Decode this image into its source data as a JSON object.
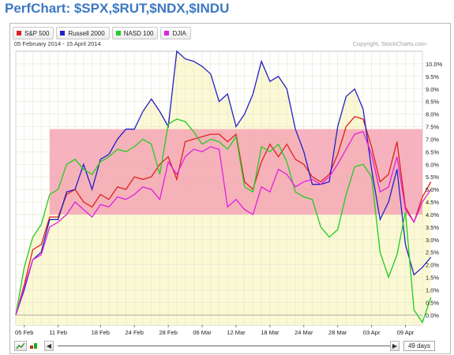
{
  "page_title": "PerfChart: $SPX,$RUT,$NDX,$INDU",
  "date_range": "05 February 2014 - 15 April 2014",
  "copyright": "Copyright, StockCharts.com",
  "legend": [
    {
      "label": "S&P 500",
      "color": "#e02020"
    },
    {
      "label": "Russell 2000",
      "color": "#2020c8"
    },
    {
      "label": "NASD 100",
      "color": "#22cc22"
    },
    {
      "label": "DJIA",
      "color": "#e020e0"
    }
  ],
  "controls": {
    "days_label": "49 days",
    "left_arrow": "◀",
    "right_arrow": "▶"
  },
  "icons": [
    "line-chart-icon",
    "bar-chart-icon",
    "left-arrow-icon",
    "right-arrow-icon"
  ],
  "chart_data": {
    "type": "line",
    "x_ticks": [
      "05 Feb",
      "11 Feb",
      "18 Feb",
      "24 Feb",
      "28 Feb",
      "06 Mar",
      "12 Mar",
      "18 Mar",
      "24 Mar",
      "28 Mar",
      "03 Apr",
      "09 Apr"
    ],
    "x_tick_index": [
      1,
      5,
      10,
      14,
      18,
      22,
      26,
      30,
      34,
      38,
      42,
      46
    ],
    "y_ticks": [
      "0.0%",
      "0.5%",
      "1.0%",
      "1.5%",
      "2.0%",
      "2.5%",
      "3.0%",
      "3.5%",
      "4.0%",
      "4.5%",
      "5.0%",
      "5.5%",
      "6.0%",
      "6.5%",
      "7.0%",
      "7.5%",
      "8.0%",
      "8.5%",
      "9.0%",
      "9.5%",
      "10.0%"
    ],
    "ylim": [
      -0.4,
      10.5
    ],
    "xlim": [
      0,
      48
    ],
    "band": {
      "from": 4.0,
      "to": 7.4,
      "color": "#f4a6b4"
    },
    "lower_fill_color": "#fbf8d4",
    "series": [
      {
        "name": "S&P 500",
        "color": "#e02020",
        "values": [
          0.0,
          1.2,
          2.6,
          2.8,
          3.9,
          3.9,
          4.8,
          5.0,
          4.5,
          4.3,
          4.8,
          4.6,
          5.1,
          5.0,
          5.5,
          5.4,
          5.5,
          6.0,
          6.3,
          5.4,
          6.9,
          7.0,
          7.1,
          7.2,
          7.2,
          6.9,
          7.2,
          5.3,
          5.0,
          6.1,
          6.8,
          6.3,
          6.8,
          6.2,
          6.0,
          5.5,
          5.3,
          5.6,
          6.4,
          7.5,
          7.9,
          7.8,
          6.7,
          5.3,
          5.6,
          6.9,
          4.3,
          3.7,
          4.7,
          5.3
        ]
      },
      {
        "name": "Russell 2000",
        "color": "#2020c8",
        "values": [
          0.0,
          1.0,
          2.2,
          2.5,
          3.8,
          3.8,
          4.9,
          5.0,
          6.0,
          5.0,
          6.2,
          6.4,
          7.0,
          7.4,
          7.4,
          8.1,
          8.6,
          8.1,
          7.5,
          10.5,
          10.2,
          10.1,
          9.9,
          9.6,
          8.5,
          8.8,
          7.5,
          8.0,
          8.8,
          10.1,
          9.3,
          9.5,
          9.0,
          7.4,
          6.5,
          5.2,
          5.2,
          5.3,
          7.5,
          8.7,
          9.0,
          8.2,
          5.8,
          3.8,
          4.5,
          5.8,
          2.8,
          1.6,
          1.9,
          2.3
        ]
      },
      {
        "name": "NASD 100",
        "color": "#22cc22",
        "values": [
          0.0,
          1.9,
          3.1,
          3.6,
          4.8,
          5.0,
          6.0,
          6.2,
          5.8,
          5.6,
          6.1,
          6.3,
          6.6,
          6.5,
          6.7,
          7.0,
          6.8,
          5.6,
          7.6,
          7.8,
          7.7,
          7.3,
          6.8,
          7.0,
          6.9,
          6.6,
          7.1,
          5.1,
          4.9,
          6.7,
          6.5,
          6.8,
          6.1,
          4.9,
          4.7,
          4.6,
          3.5,
          3.1,
          3.4,
          4.8,
          5.9,
          6.0,
          5.5,
          2.5,
          1.5,
          2.4,
          4.1,
          0.2,
          -0.3,
          0.7
        ]
      },
      {
        "name": "DJIA",
        "color": "#e020e0",
        "values": [
          0.0,
          1.1,
          2.2,
          2.4,
          3.5,
          3.7,
          4.0,
          4.5,
          4.2,
          3.9,
          4.4,
          4.3,
          4.7,
          4.6,
          4.8,
          5.1,
          5.0,
          4.6,
          6.1,
          5.6,
          6.3,
          6.6,
          6.5,
          6.7,
          6.6,
          4.3,
          4.6,
          4.2,
          4.0,
          5.1,
          4.9,
          5.8,
          5.6,
          5.1,
          5.3,
          5.4,
          5.2,
          5.5,
          6.0,
          6.6,
          7.2,
          7.3,
          6.4,
          4.9,
          5.1,
          6.3,
          4.2,
          3.7,
          4.5,
          5.0
        ]
      }
    ]
  }
}
